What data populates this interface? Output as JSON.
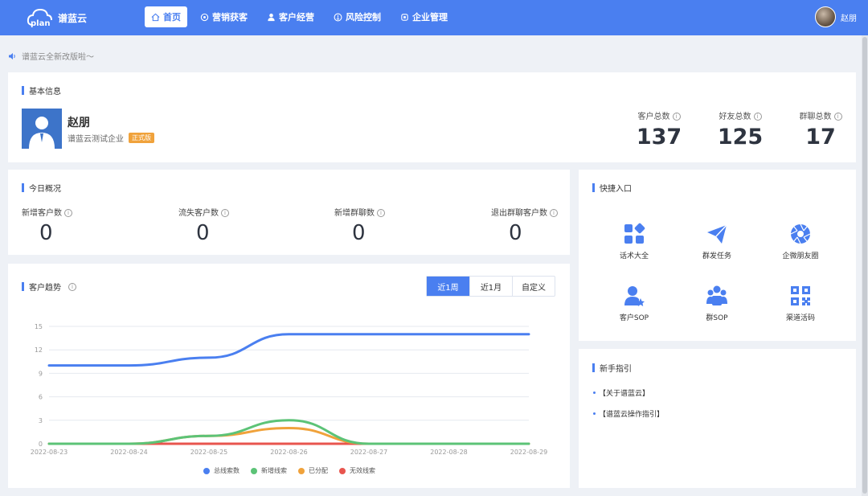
{
  "header": {
    "logo_text": "plan",
    "app_name": "谱蓝云",
    "nav": [
      {
        "label": "首页",
        "icon": "home-icon",
        "active": true
      },
      {
        "label": "营销获客",
        "icon": "marketing-icon"
      },
      {
        "label": "客户经营",
        "icon": "user-icon"
      },
      {
        "label": "风险控制",
        "icon": "shield-icon"
      },
      {
        "label": "企业管理",
        "icon": "enterprise-icon"
      }
    ],
    "user_name": "赵朋"
  },
  "notice": {
    "text": "谱蓝云全新改版啦～"
  },
  "basic_info": {
    "title": "基本信息",
    "name": "赵朋",
    "company": "谱蓝云测试企业",
    "badge": "正式版",
    "stats": [
      {
        "label": "客户总数",
        "value": "137"
      },
      {
        "label": "好友总数",
        "value": "125"
      },
      {
        "label": "群聊总数",
        "value": "17"
      }
    ]
  },
  "today": {
    "title": "今日概况",
    "stats": [
      {
        "label": "新增客户数",
        "value": "0"
      },
      {
        "label": "流失客户数",
        "value": "0"
      },
      {
        "label": "新增群聊数",
        "value": "0"
      },
      {
        "label": "退出群聊客户数",
        "value": "0"
      }
    ]
  },
  "trend": {
    "title": "客户趋势",
    "tabs": [
      "近1周",
      "近1月",
      "自定义"
    ],
    "active_tab": 0
  },
  "chart_data": {
    "type": "line",
    "x": [
      "2022-08-23",
      "2022-08-24",
      "2022-08-25",
      "2022-08-26",
      "2022-08-27",
      "2022-08-28",
      "2022-08-29"
    ],
    "yticks": [
      "0",
      "3",
      "6",
      "9",
      "12",
      "15"
    ],
    "ylim": [
      0,
      15
    ],
    "series": [
      {
        "name": "总线索数",
        "color": "#4a7ff0",
        "values": [
          10,
          10,
          11,
          14,
          14,
          14,
          14
        ]
      },
      {
        "name": "新增线索",
        "color": "#5cc377",
        "values": [
          0,
          0,
          1,
          3,
          0,
          0,
          0
        ]
      },
      {
        "name": "已分配",
        "color": "#f0a23b",
        "values": [
          0,
          0,
          1,
          2,
          0,
          0,
          0
        ]
      },
      {
        "name": "无效线索",
        "color": "#e8554e",
        "values": [
          0,
          0,
          0,
          0,
          0,
          0,
          0
        ]
      }
    ],
    "grid": true,
    "legend": "bottom"
  },
  "quick_entry": {
    "title": "快捷入口",
    "items": [
      {
        "label": "话术大全",
        "icon": "script-grid-icon"
      },
      {
        "label": "群发任务",
        "icon": "paper-plane-icon"
      },
      {
        "label": "企微朋友圈",
        "icon": "aperture-icon"
      },
      {
        "label": "客户SOP",
        "icon": "customer-sop-icon"
      },
      {
        "label": "群SOP",
        "icon": "group-sop-icon"
      },
      {
        "label": "渠道活码",
        "icon": "qr-code-icon"
      }
    ]
  },
  "guide": {
    "title": "新手指引",
    "items": [
      "【关于谱蓝云】",
      "【谱蓝云操作指引】"
    ]
  }
}
